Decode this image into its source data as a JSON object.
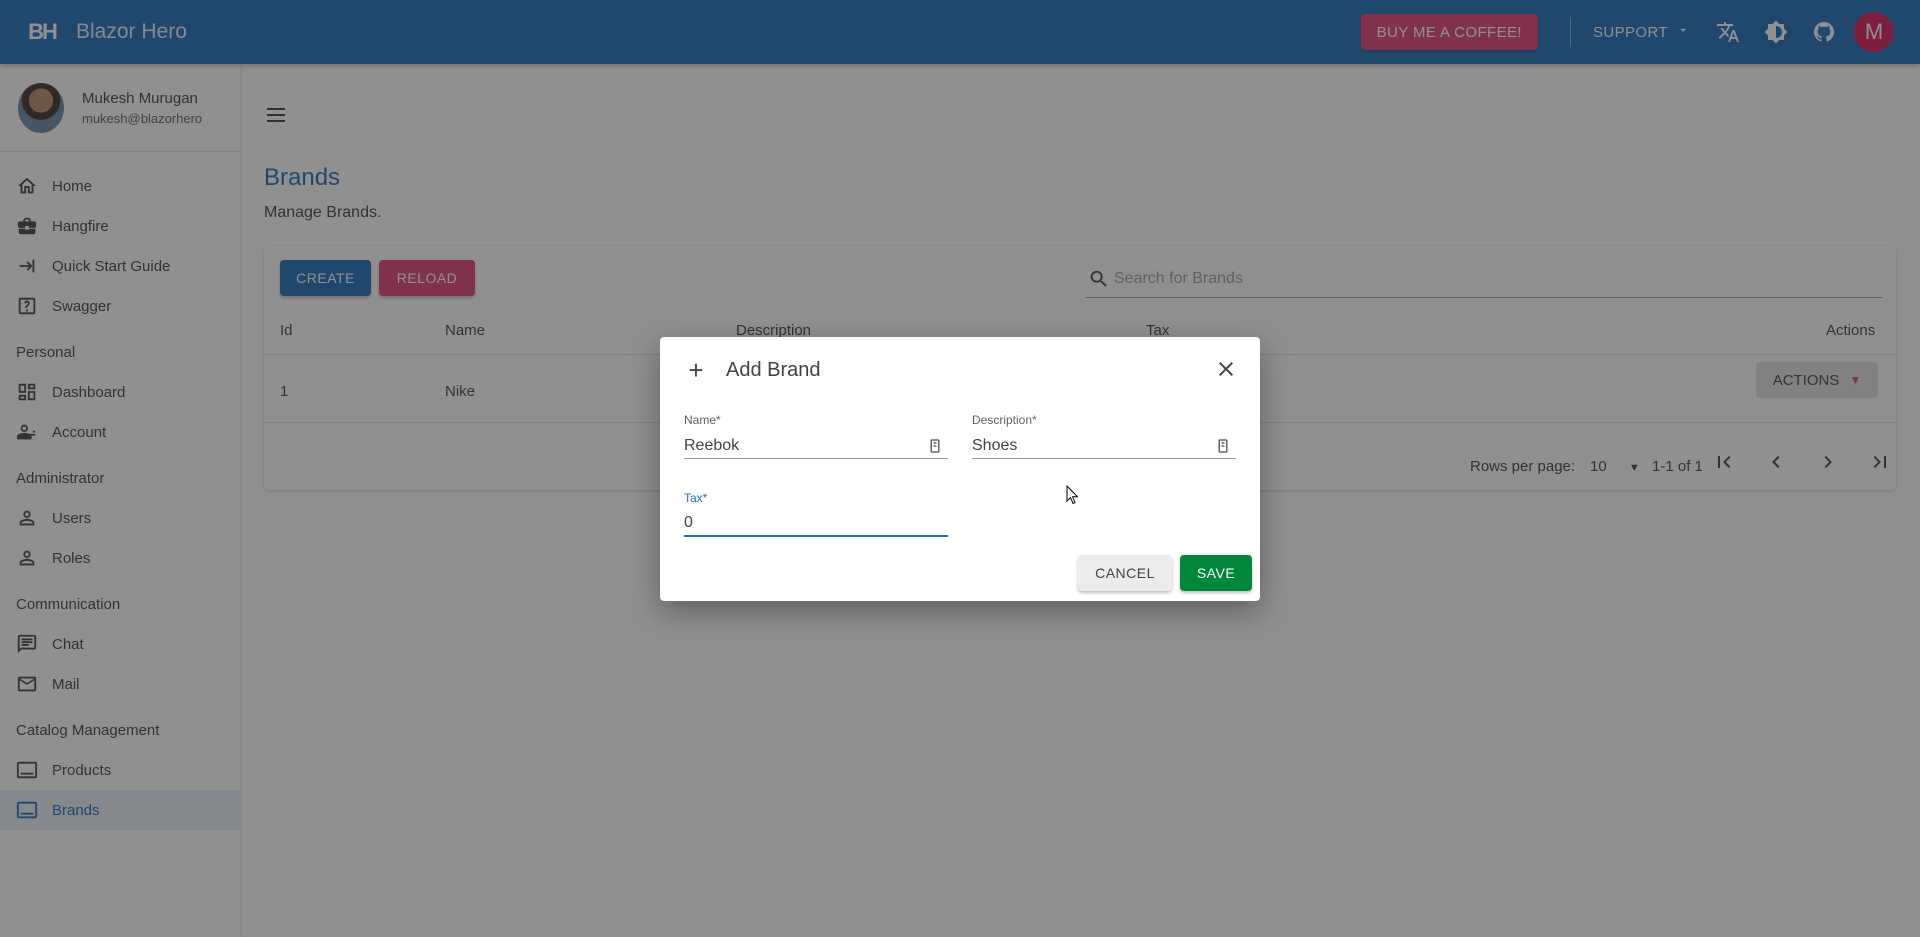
{
  "appbar": {
    "logo": "BH",
    "title": "Blazor Hero",
    "coffee_label": "BUY ME A COFFEE!",
    "support_label": "SUPPORT",
    "avatar_letter": "M",
    "color": "#1e6fb8"
  },
  "user": {
    "name": "Mukesh Murugan",
    "email": "mukesh@blazorhero"
  },
  "nav": {
    "home": "Home",
    "hangfire": "Hangfire",
    "quick_start": "Quick Start Guide",
    "swagger": "Swagger",
    "section_personal": "Personal",
    "dashboard": "Dashboard",
    "account": "Account",
    "section_admin": "Administrator",
    "users": "Users",
    "roles": "Roles",
    "section_comm": "Communication",
    "chat": "Chat",
    "mail": "Mail",
    "section_catalog": "Catalog Management",
    "products": "Products",
    "brands": "Brands"
  },
  "page": {
    "title": "Brands",
    "subtitle": "Manage Brands.",
    "create_label": "CREATE",
    "reload_label": "RELOAD",
    "search_placeholder": "Search for Brands",
    "columns": [
      "Id",
      "Name",
      "Description",
      "Tax",
      "Actions"
    ],
    "rows": [
      {
        "id": "1",
        "name": "Nike",
        "actions_label": "ACTIONS"
      }
    ],
    "rows_per_page_label": "Rows per page:",
    "rows_per_page_value": "10",
    "range_label": "1-1 of 1"
  },
  "dialog": {
    "title": "Add Brand",
    "name_label": "Name*",
    "name_value": "Reebok",
    "description_label": "Description*",
    "description_value": "Shoes",
    "tax_label": "Tax*",
    "tax_value": "0",
    "cancel_label": "CANCEL",
    "save_label": "SAVE"
  }
}
